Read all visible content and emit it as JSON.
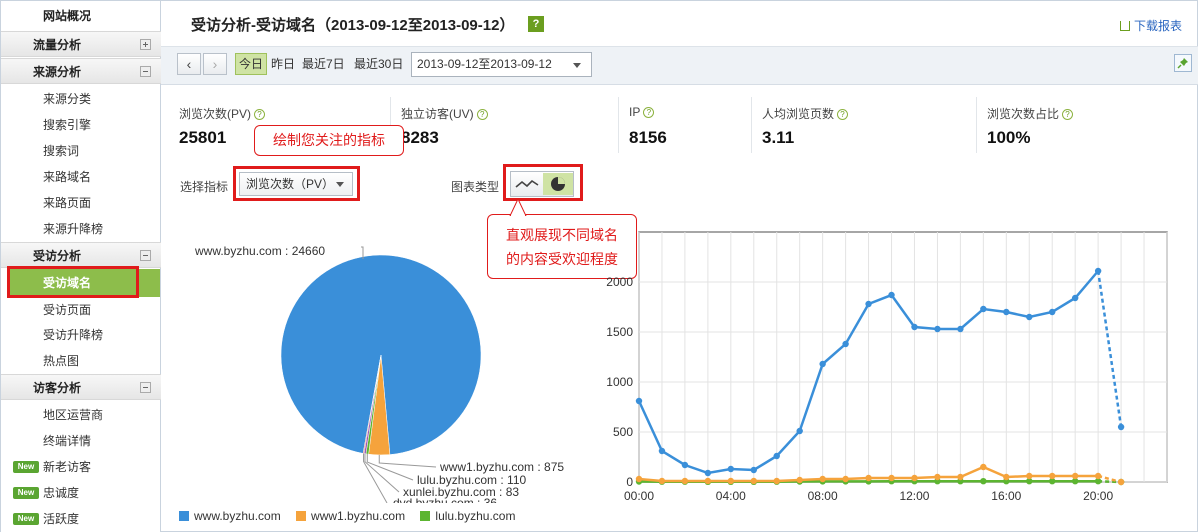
{
  "sidebar": {
    "overview": "网站概况",
    "sections": [
      {
        "title": "流量分析",
        "expanded": false,
        "items": []
      },
      {
        "title": "来源分析",
        "expanded": true,
        "items": [
          "来源分类",
          "搜索引擎",
          "搜索词",
          "来路域名",
          "来路页面",
          "来源升降榜"
        ]
      },
      {
        "title": "受访分析",
        "expanded": true,
        "items": [
          "受访域名",
          "受访页面",
          "受访升降榜",
          "热点图"
        ],
        "active": "受访域名"
      },
      {
        "title": "访客分析",
        "expanded": true,
        "items": [
          "地区运营商",
          "终端详情",
          "新老访客",
          "忠诚度",
          "活跃度"
        ],
        "new_badge": "New"
      }
    ]
  },
  "header": {
    "title": "受访分析-受访域名（2013-09-12至2013-09-12）",
    "help": "?",
    "download": "下载报表"
  },
  "toolbar": {
    "prev": "‹",
    "next": "›",
    "periods": [
      "今日",
      "昨日",
      "最近7日",
      "最近30日"
    ],
    "active_period": "今日",
    "date_range": "2013-09-12至2013-09-12"
  },
  "metrics": [
    {
      "label": "浏览次数(PV)",
      "value": "25801"
    },
    {
      "label": "独立访客(UV)",
      "value": "8283"
    },
    {
      "label": "IP",
      "value": "8156"
    },
    {
      "label": "人均浏览页数",
      "value": "3.11"
    },
    {
      "label": "浏览次数占比",
      "value": "100%"
    }
  ],
  "controls": {
    "indicator_label": "选择指标",
    "indicator_value": "浏览次数（PV）",
    "chart_type_label": "图表类型"
  },
  "callouts": {
    "metric_tip": "绘制您关注的指标",
    "chart_tip_line1": "直观展现不同域名",
    "chart_tip_line2": "的内容受欢迎程度"
  },
  "colors": {
    "accent": "#8dbd4b",
    "blue": "#3a8fd9",
    "orange": "#f5a33c",
    "green": "#5cb531",
    "callout_red": "#e01b1b"
  },
  "chart_data": [
    {
      "type": "pie",
      "slices": [
        {
          "name": "www.byzhu.com",
          "value": 24660,
          "label": "www.byzhu.com : 24660",
          "color": "#3a8fd9"
        },
        {
          "name": "www1.byzhu.com",
          "value": 875,
          "label": "www1.byzhu.com : 875",
          "color": "#f5a33c"
        },
        {
          "name": "lulu.byzhu.com",
          "value": 110,
          "label": "lulu.byzhu.com : 110",
          "color": "#5cb531"
        },
        {
          "name": "xunlei.byzhu.com",
          "value": 83,
          "label": "xunlei.byzhu.com : 83",
          "color": "#9b59b6"
        },
        {
          "name": "dvd.byzhu.com",
          "value": 36,
          "label": "dvd.byzhu.com : 36",
          "color": "#e74c3c"
        }
      ],
      "legend": [
        "www.byzhu.com",
        "www1.byzhu.com",
        "lulu.byzhu.com"
      ],
      "legend_position": "bottom-left"
    },
    {
      "type": "line",
      "x": [
        "00:00",
        "01:00",
        "02:00",
        "03:00",
        "04:00",
        "05:00",
        "06:00",
        "07:00",
        "08:00",
        "09:00",
        "10:00",
        "11:00",
        "12:00",
        "13:00",
        "14:00",
        "15:00",
        "16:00",
        "17:00",
        "18:00",
        "19:00",
        "20:00",
        "21:00"
      ],
      "x_ticks": [
        "00:00",
        "04:00",
        "08:00",
        "12:00",
        "16:00",
        "20:00"
      ],
      "y_ticks": [
        "0",
        "500",
        "1000",
        "1500",
        "2000"
      ],
      "ylim": [
        0,
        2500
      ],
      "grid": true,
      "series": [
        {
          "name": "www.byzhu.com",
          "color": "#3a8fd9",
          "values": [
            810,
            310,
            170,
            90,
            130,
            120,
            260,
            510,
            1180,
            1380,
            1780,
            1870,
            1550,
            1530,
            1530,
            1730,
            1700,
            1650,
            1700,
            1840,
            2110,
            550
          ],
          "dashed_last": true
        },
        {
          "name": "www1.byzhu.com",
          "color": "#f5a33c",
          "values": [
            30,
            10,
            10,
            10,
            10,
            10,
            10,
            20,
            30,
            30,
            40,
            40,
            40,
            50,
            50,
            150,
            50,
            60,
            60,
            60,
            60,
            0
          ],
          "dashed_last": true
        },
        {
          "name": "lulu.byzhu.com",
          "color": "#5cb531",
          "values": [
            5,
            3,
            3,
            2,
            2,
            2,
            3,
            5,
            6,
            6,
            6,
            8,
            8,
            8,
            8,
            8,
            8,
            8,
            8,
            8,
            8,
            0
          ],
          "dashed_last": true
        }
      ]
    }
  ]
}
